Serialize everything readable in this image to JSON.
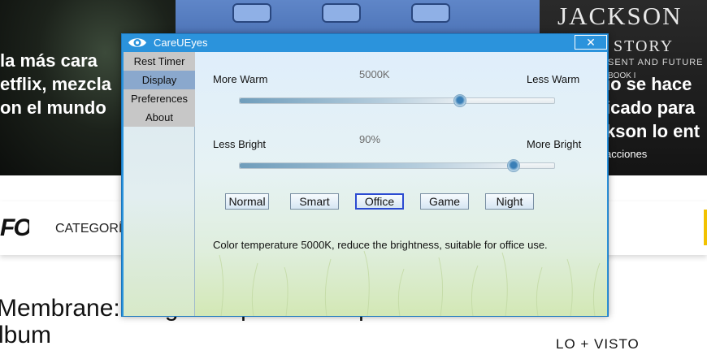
{
  "background_page": {
    "hero_left_lines": [
      "la más cara",
      "etflix, mezcla",
      "on el mundo"
    ],
    "hero_right_lines": [
      "io se hace",
      "icado para",
      "kson lo ent"
    ],
    "book_title": "JACKSON",
    "book_subtitle": "STORY",
    "book_tagline": "SENT AND FUTURE",
    "book_volume": "BOOK I",
    "reactions": "acciones",
    "logo_fragment": "FO",
    "nav_category": "CATEGORÍ",
    "article_title_line1": "Membrane: Programa para crear portadas de",
    "article_title_line2": "lbum",
    "sidebar_heading": "LO + VISTO"
  },
  "window": {
    "title": "CareUEyes",
    "close_symbol": "✕",
    "nav": [
      {
        "label": "Rest Timer",
        "active": false
      },
      {
        "label": "Display",
        "active": true
      },
      {
        "label": "Preferences",
        "active": false
      },
      {
        "label": "About",
        "active": false
      }
    ],
    "temperature": {
      "left_label": "More Warm",
      "right_label": "Less Warm",
      "value": "5000K",
      "position": 0.7
    },
    "brightness": {
      "left_label": "Less Bright",
      "right_label": "More Bright",
      "value": "90%",
      "position": 0.87
    },
    "modes": [
      {
        "label": "Normal",
        "active": false
      },
      {
        "label": "Smart",
        "active": false
      },
      {
        "label": "Office",
        "active": true
      },
      {
        "label": "Game",
        "active": false
      },
      {
        "label": "Night",
        "active": false
      }
    ],
    "description": "Color temperature 5000K, reduce the brightness, suitable for office use."
  },
  "colors": {
    "titlebar": "#2b93dc",
    "active_nav": "#8aa8cd",
    "active_mode_border": "#2c4bd1",
    "slider_thumb": "#3a7fb7"
  },
  "icons": {
    "app": "eye-icon",
    "close": "close-icon",
    "slider_thumb": "circle-thumb"
  }
}
